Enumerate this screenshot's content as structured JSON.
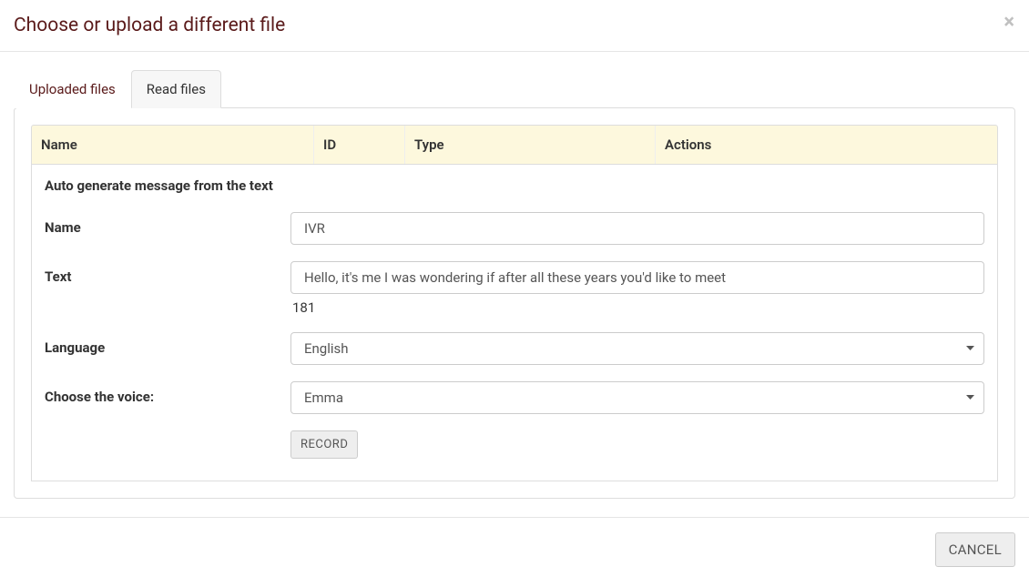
{
  "header": {
    "title": "Choose or upload a different file"
  },
  "tabs": {
    "uploaded": "Uploaded files",
    "read": "Read files"
  },
  "table": {
    "columns": {
      "name": "Name",
      "id": "ID",
      "type": "Type",
      "actions": "Actions"
    }
  },
  "form": {
    "heading": "Auto generate message from the text",
    "labels": {
      "name": "Name",
      "text": "Text",
      "language": "Language",
      "voice": "Choose the voice:"
    },
    "values": {
      "name": "IVR",
      "text": "Hello, it's me I was wondering if after all these years you'd like to meet",
      "counter": "181",
      "language": "English",
      "voice": "Emma"
    },
    "buttons": {
      "record": "RECORD"
    }
  },
  "footer": {
    "cancel": "CANCEL"
  }
}
